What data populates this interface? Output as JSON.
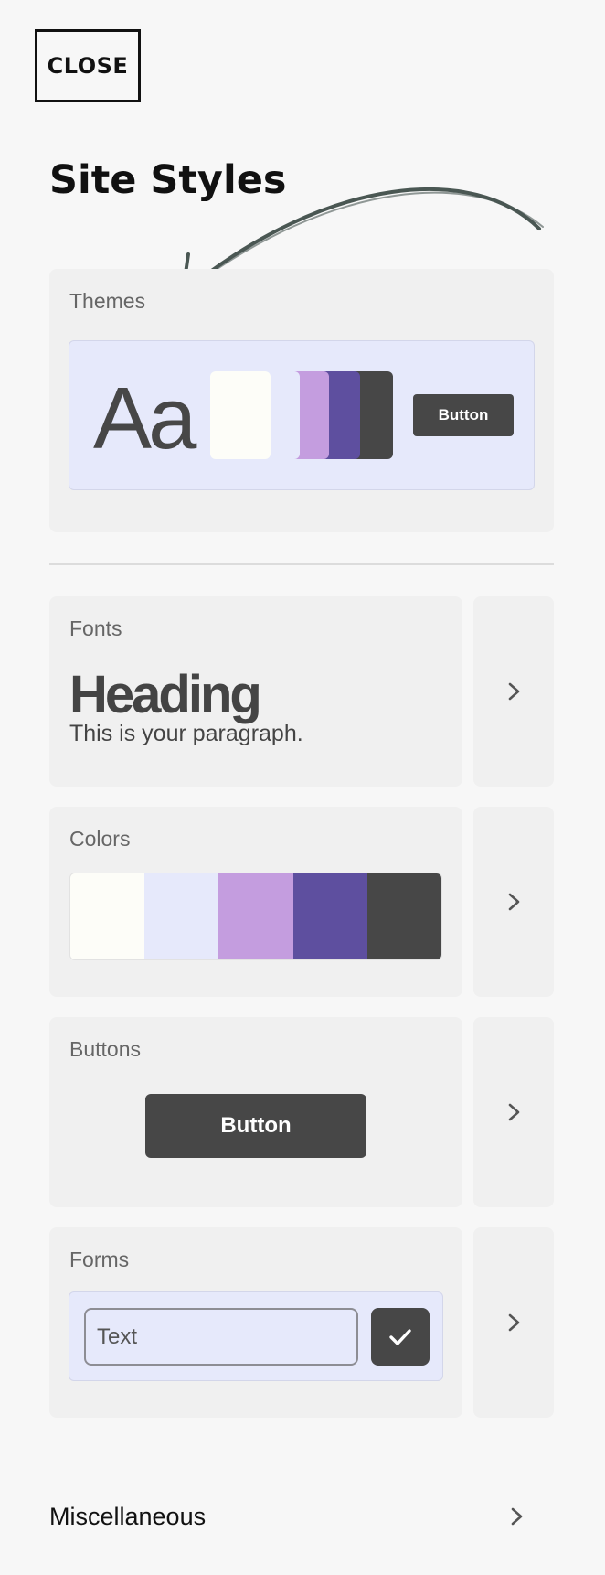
{
  "close_label": "CLOSE",
  "title": "Site Styles",
  "themes": {
    "label": "Themes",
    "sample_text": "Aa",
    "button_label": "Button",
    "swatches": [
      "#fdfdf8",
      "#e6e9fb",
      "#c49ddf",
      "#5e4f9f",
      "#474747"
    ]
  },
  "fonts": {
    "label": "Fonts",
    "heading_sample": "Heading",
    "paragraph_sample": "This is your paragraph."
  },
  "colors": {
    "label": "Colors",
    "palette": [
      "#fdfdf8",
      "#e6e9fb",
      "#c49ddf",
      "#5e4f9f",
      "#474747"
    ]
  },
  "buttons": {
    "label": "Buttons",
    "button_label": "Button"
  },
  "forms": {
    "label": "Forms",
    "input_value": "Text"
  },
  "misc": {
    "label": "Miscellaneous"
  },
  "icons": {
    "chevron": "chevron-right-icon",
    "check": "check-icon",
    "arrow": "hand-drawn-arrow"
  }
}
